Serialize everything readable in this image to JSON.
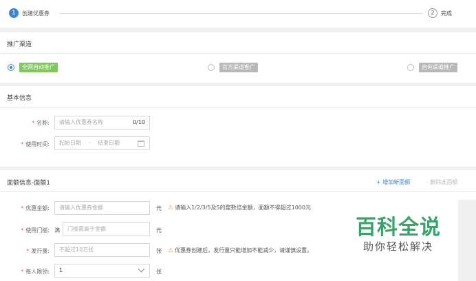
{
  "steps": [
    {
      "num": "1",
      "label": "创建优惠券"
    },
    {
      "num": "2",
      "label": "完成"
    }
  ],
  "channel": {
    "title": "推广渠道",
    "options": [
      {
        "label": "全网自动推广",
        "selected": true
      },
      {
        "label": "官方渠道推广",
        "selected": false
      },
      {
        "label": "自有渠道推广",
        "selected": false
      }
    ]
  },
  "basic": {
    "title": "基本信息",
    "name_label": "名称:",
    "name_placeholder": "请输入优惠券名称",
    "name_counter": "0/10",
    "time_label": "使用时间:",
    "start_placeholder": "起始日期",
    "sep": "-",
    "end_placeholder": "结束日期"
  },
  "denom": {
    "title": "面额信息-面额1",
    "add_link": "+ 增加新面额",
    "delete_link": "- 删除此面额",
    "amount_label": "优惠金额:",
    "amount_placeholder": "请输入优惠券金额",
    "amount_unit": "元",
    "amount_hint": "请输入1/2/3/5及5的整数倍金额，面额不得超过1000元",
    "threshold_label": "使用门槛:",
    "threshold_prefix": "满",
    "threshold_placeholder": "门槛需高于金额",
    "threshold_unit": "元",
    "issue_label": "发行量:",
    "issue_placeholder": "不超过10万张",
    "issue_unit": "张",
    "issue_hint": "优惠券创建后，发行量只能增加不能减少，请谨慎设置。",
    "limit_label": "每人限领:",
    "limit_value": "1",
    "limit_unit": "张"
  },
  "watermark": {
    "top": "百科全说",
    "bottom": "助你轻松解决"
  },
  "colors": {
    "accent": "#3a86d6",
    "green": "#7fc95c",
    "warning": "#f08a24",
    "required": "#e35d5d",
    "watermark": "#3aa26a"
  }
}
